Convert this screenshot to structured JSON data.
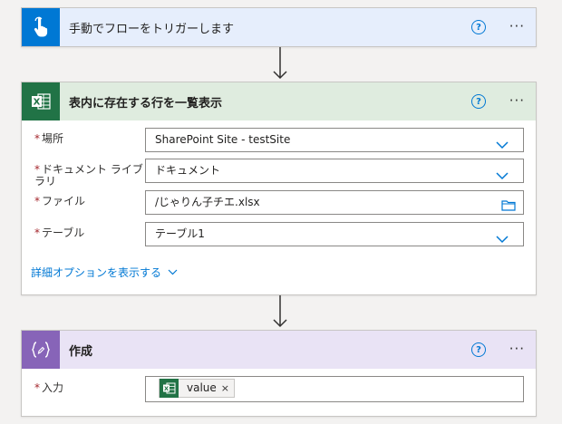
{
  "trigger": {
    "title": "手動でフローをトリガーします",
    "help": "?",
    "more": "···",
    "color": "#0078d4"
  },
  "excel": {
    "title": "表内に存在する行を一覧表示",
    "help": "?",
    "more": "···",
    "color": "#217346",
    "icon_text": "X",
    "fields": [
      {
        "required": "*",
        "label": "場所",
        "value": "SharePoint Site - testSite"
      },
      {
        "required": "*",
        "label": "ドキュメント ライブラリ",
        "value": "ドキュメント"
      },
      {
        "required": "*",
        "label": "ファイル",
        "value": "/じゃりん子チエ.xlsx"
      },
      {
        "required": "*",
        "label": "テーブル",
        "value": "テーブル1"
      }
    ],
    "advanced_link": "詳細オプションを表示する"
  },
  "compose": {
    "title": "作成",
    "help": "?",
    "more": "···",
    "color": "#8764b8",
    "input": {
      "required": "*",
      "label": "入力",
      "token_text": "value",
      "token_remove": "×",
      "token_icon_text": "X"
    }
  },
  "icons": {
    "trigger": "hand-pointer-icon",
    "excel": "excel-icon",
    "compose": "compose-braces-icon",
    "dropdown": "chevron-down-icon",
    "file_picker": "folder-icon",
    "connector": "arrow-down-icon"
  }
}
